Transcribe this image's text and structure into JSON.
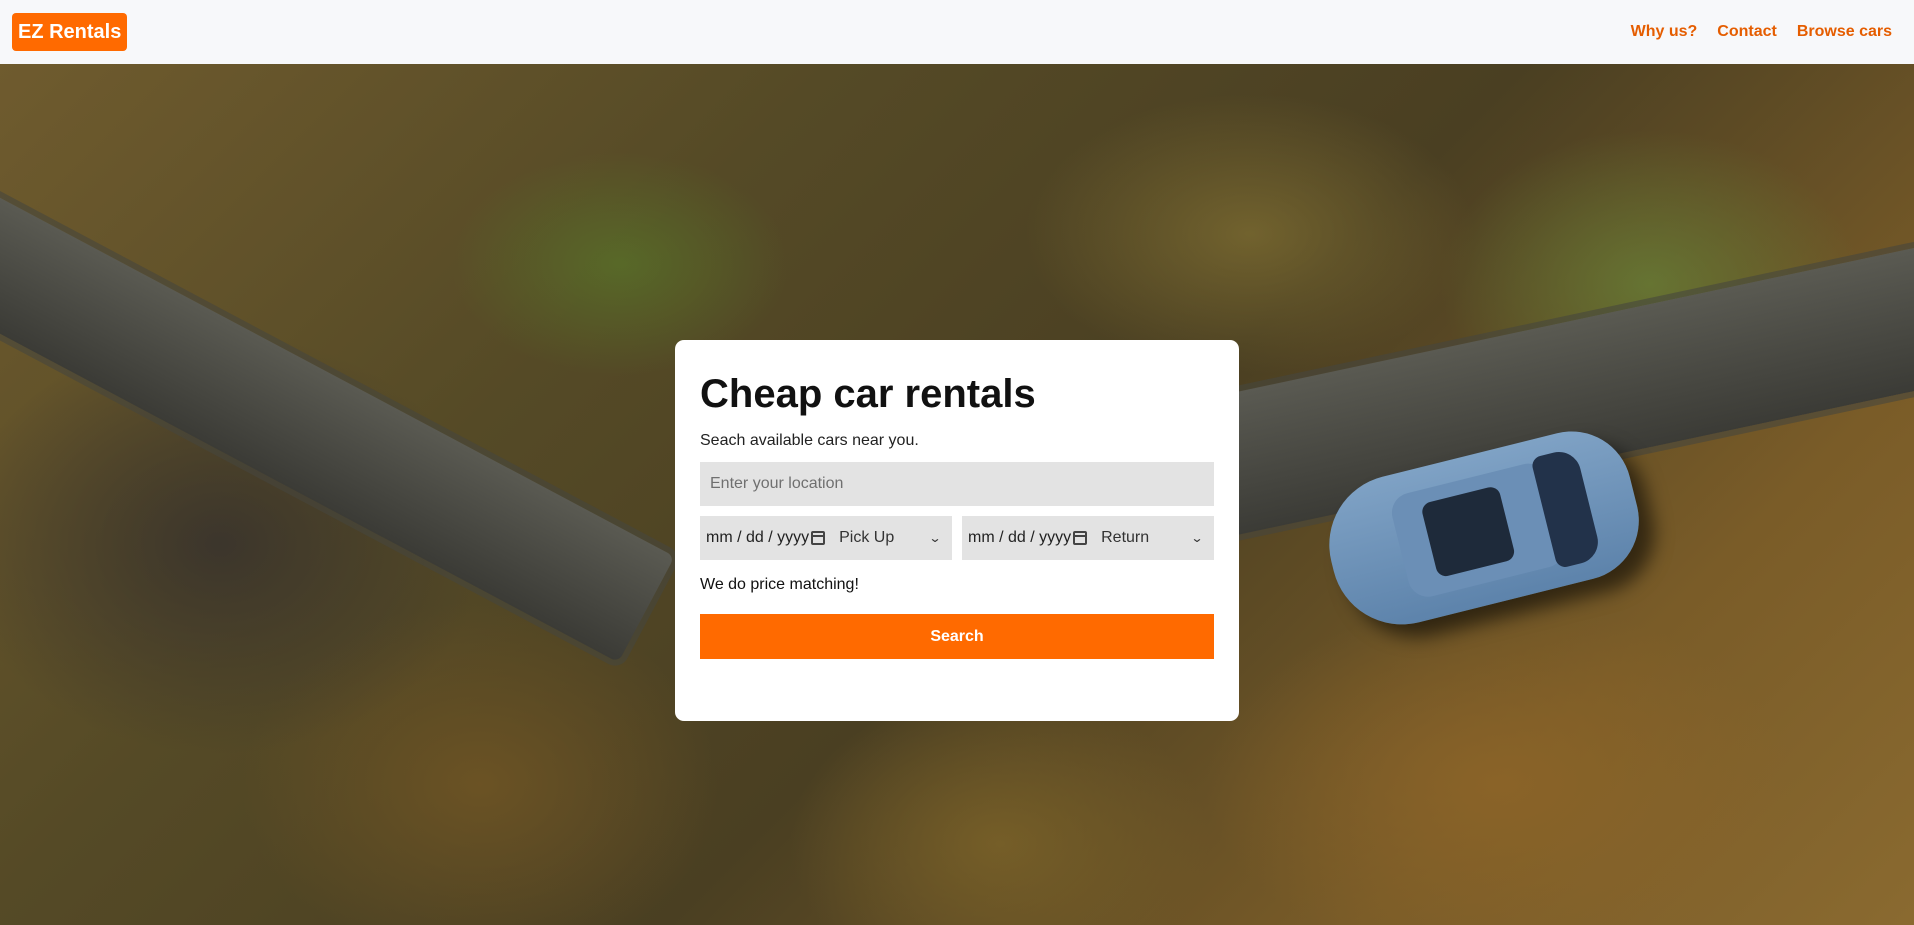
{
  "nav": {
    "brand": "EZ Rentals",
    "links": [
      "Why us?",
      "Contact",
      "Browse cars"
    ]
  },
  "hero": {
    "title": "Cheap car rentals",
    "subtitle": "Seach available cars near you.",
    "location_placeholder": "Enter your location",
    "pickup": {
      "date_placeholder": "mm / dd / yyyy",
      "time_label": "Pick Up"
    },
    "return": {
      "date_placeholder": "mm / dd / yyyy",
      "time_label": "Return"
    },
    "note": "We do price matching!",
    "search_label": "Search"
  },
  "icons": {
    "calendar": "calendar-icon",
    "chevron": "chevron-down-icon"
  },
  "colors": {
    "accent": "#ff6a00",
    "nav_bg": "#f7f8fa",
    "input_bg": "#e3e3e3"
  }
}
